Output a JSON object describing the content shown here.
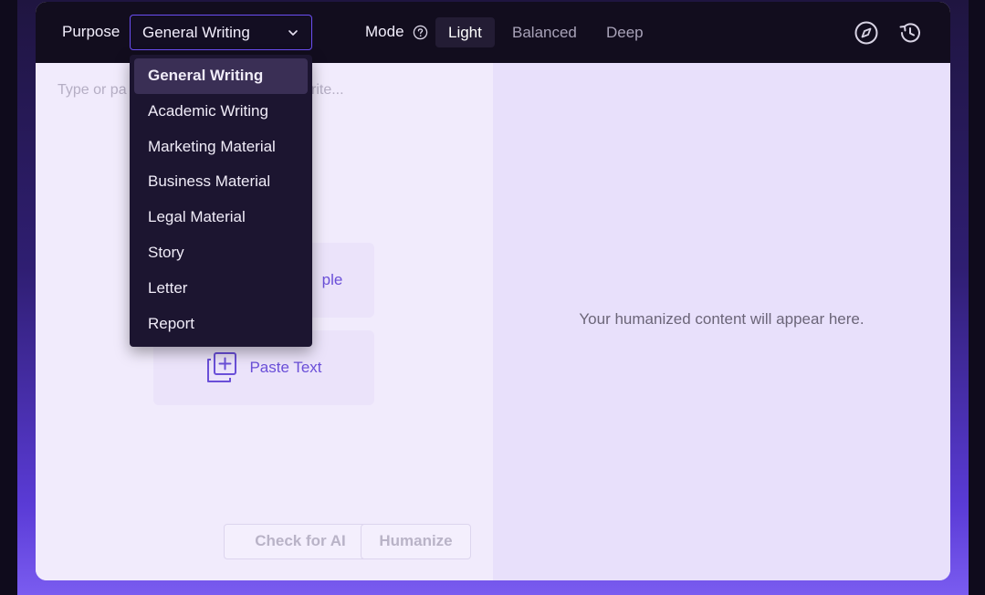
{
  "toolbar": {
    "purpose_label": "Purpose",
    "purpose_selected": "General Writing",
    "mode_label": "Mode",
    "modes": [
      {
        "label": "Light",
        "active": true
      },
      {
        "label": "Balanced",
        "active": false
      },
      {
        "label": "Deep",
        "active": false
      }
    ],
    "icons": [
      "compass-icon",
      "history-icon"
    ]
  },
  "input": {
    "placeholder": "Type or paste text to rewrite...",
    "visible_placeholder_left": "Type or pa",
    "visible_placeholder_right": "rite...",
    "try_sample_partial": "ple",
    "paste_label": "Paste Text"
  },
  "buttons": {
    "check_ai": "Check for AI",
    "humanize": "Humanize"
  },
  "output": {
    "placeholder": "Your humanized content will appear here."
  },
  "dropdown": {
    "options": [
      "General Writing",
      "Academic Writing",
      "Marketing Material",
      "Business Material",
      "Legal Material",
      "Story",
      "Letter",
      "Report"
    ],
    "selected_index": 0
  },
  "colors": {
    "accent": "#6b4ef2",
    "toolbar_bg": "#120d1e",
    "left_pane": "#f1ebfc",
    "right_pane": "#e8e0fb"
  }
}
